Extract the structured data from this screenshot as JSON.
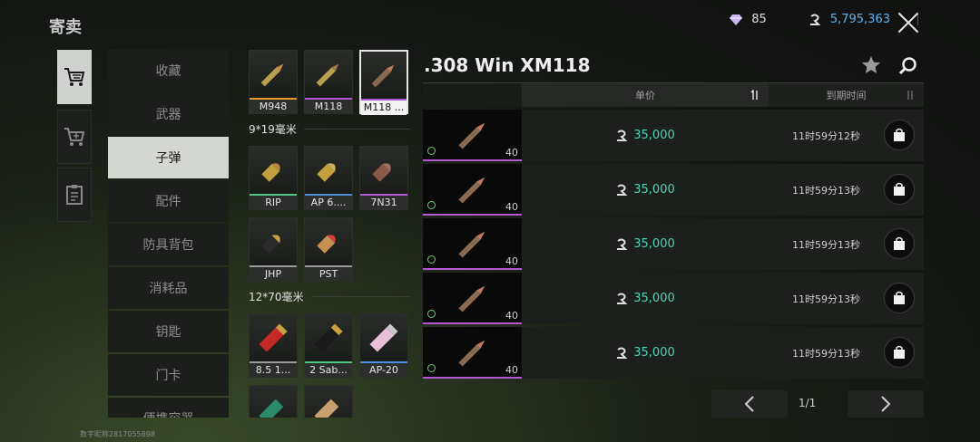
{
  "header": {
    "title": "寄卖",
    "gems": "85",
    "coins": "5,795,363"
  },
  "categories": [
    {
      "label": "收藏"
    },
    {
      "label": "武器"
    },
    {
      "label": "子弹"
    },
    {
      "label": "配件"
    },
    {
      "label": "防具背包"
    },
    {
      "label": "消耗品"
    },
    {
      "label": "钥匙"
    },
    {
      "label": "门卡"
    },
    {
      "label": "便携容器"
    }
  ],
  "ammo": {
    "top": [
      {
        "label": "M948",
        "color": "#e59a2a"
      },
      {
        "label": "M118",
        "color": "#b25ad6"
      },
      {
        "label": "M118 ...",
        "color": "#b25ad6"
      }
    ],
    "group1_title": "9*19毫米",
    "group1": [
      {
        "label": "RIP",
        "color": "#4fc58a"
      },
      {
        "label": "AP 6....",
        "color": "#4e90d8"
      },
      {
        "label": "7N31",
        "color": "#b25ad6"
      },
      {
        "label": "JHP",
        "color": "#9a9a9a"
      },
      {
        "label": "PST",
        "color": "#9a9a9a"
      }
    ],
    "group2_title": "12*70毫米",
    "group2": [
      {
        "label": "8.5 1...",
        "color": "#9a9a9a"
      },
      {
        "label": "2 Sab...",
        "color": "#4fc58a"
      },
      {
        "label": "AP-20",
        "color": "#4e90d8"
      }
    ]
  },
  "detail": {
    "title": ".308 Win XM118",
    "col_price": "单价",
    "col_expire": "到期时间",
    "rows": [
      {
        "qty": "40",
        "price": "35,000",
        "expire": "11时59分12秒"
      },
      {
        "qty": "40",
        "price": "35,000",
        "expire": "11时59分13秒"
      },
      {
        "qty": "40",
        "price": "35,000",
        "expire": "11时59分13秒"
      },
      {
        "qty": "40",
        "price": "35,000",
        "expire": "11时59分13秒"
      },
      {
        "qty": "40",
        "price": "35,000",
        "expire": "11时59分13秒"
      }
    ],
    "page": "1/1"
  },
  "watermark": "数字昵称2817055898"
}
